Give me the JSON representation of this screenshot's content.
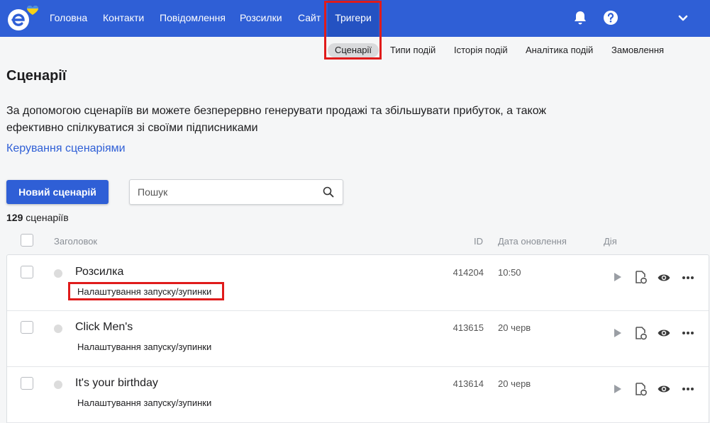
{
  "nav": {
    "items": [
      "Головна",
      "Контакти",
      "Повідомлення",
      "Розсилки",
      "Сайт",
      "Тригери"
    ]
  },
  "subnav": {
    "items": [
      "Сценарії",
      "Типи подій",
      "Історія подій",
      "Аналітика подій",
      "Замовлення"
    ]
  },
  "page": {
    "title": "Сценарії",
    "description": "За допомогою сценаріїв ви можете безперервно генерувати продажі та збільшувати прибуток, а також ефективно спілкуватися зі своїми підписниками",
    "manage_link": "Керування сценаріями",
    "new_button": "Новий сценарій",
    "search_placeholder": "Пошук",
    "count_number": "129",
    "count_label": "сценаріїв"
  },
  "table": {
    "columns": {
      "title": "Заголовок",
      "id": "ID",
      "date": "Дата оновлення",
      "action": "Дія"
    },
    "rows": [
      {
        "title": "Розсилка",
        "sub": "Налаштування запуску/зупинки",
        "id": "414204",
        "date": "10:50"
      },
      {
        "title": "Click Men's",
        "sub": "Налаштування запуску/зупинки",
        "id": "413615",
        "date": "20 черв"
      },
      {
        "title": "It's your birthday",
        "sub": "Налаштування запуску/зупинки",
        "id": "413614",
        "date": "20 черв"
      }
    ]
  },
  "colors": {
    "brand": "#2f5fd6",
    "highlight": "#e01b1b"
  }
}
